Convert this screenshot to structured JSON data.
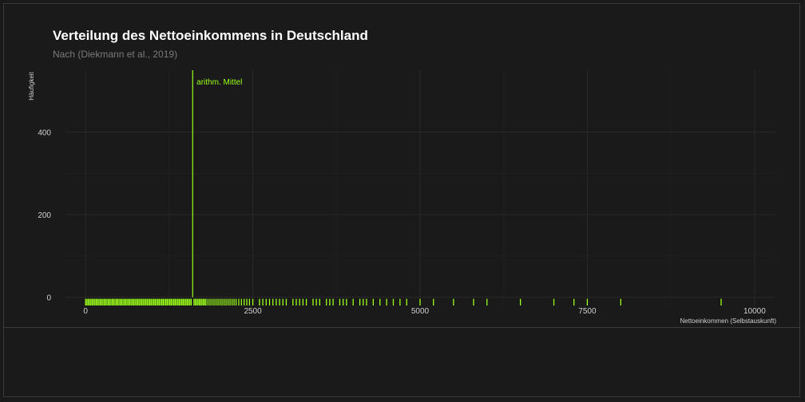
{
  "chart_data": {
    "type": "histogram",
    "title": "Verteilung des Nettoeinkommens in Deutschland",
    "subtitle": "Nach (Diekmann et al., 2019)",
    "xlabel": "Nettoeinkommen (Selbstauskunft)",
    "ylabel": "Häufigkeit",
    "xlim": [
      -300,
      10300
    ],
    "ylim": [
      -20,
      550
    ],
    "x_ticks": [
      0,
      2500,
      5000,
      7500,
      10000
    ],
    "x_tick_labels": [
      "0",
      "2500",
      "5000",
      "7500",
      "10000"
    ],
    "y_ticks": [
      0,
      200,
      400
    ],
    "y_tick_labels": [
      "0",
      "200",
      "400"
    ],
    "grid": true,
    "accent_color": "#9aff1a",
    "mean": {
      "label": "arithm. Mittel",
      "x": 1600
    },
    "bins": {
      "x": [
        1600
      ],
      "values": [
        550
      ]
    },
    "rug_x": [
      0,
      20,
      40,
      60,
      80,
      100,
      120,
      140,
      160,
      180,
      200,
      220,
      240,
      260,
      280,
      300,
      320,
      340,
      360,
      380,
      400,
      420,
      440,
      460,
      480,
      500,
      520,
      540,
      560,
      580,
      600,
      620,
      640,
      660,
      680,
      700,
      720,
      740,
      760,
      780,
      800,
      820,
      840,
      860,
      880,
      900,
      920,
      940,
      960,
      980,
      1000,
      1020,
      1040,
      1060,
      1080,
      1100,
      1120,
      1140,
      1160,
      1180,
      1200,
      1220,
      1240,
      1260,
      1280,
      1300,
      1320,
      1340,
      1360,
      1380,
      1400,
      1420,
      1440,
      1460,
      1480,
      1500,
      1520,
      1540,
      1560,
      1580,
      1620,
      1640,
      1660,
      1680,
      1700,
      1720,
      1740,
      1760,
      1780,
      1800,
      1830,
      1860,
      1890,
      1920,
      1950,
      1980,
      2010,
      2040,
      2070,
      2100,
      2130,
      2160,
      2190,
      2220,
      2250,
      2290,
      2330,
      2370,
      2410,
      2450,
      2500,
      2600,
      2650,
      2700,
      2750,
      2800,
      2850,
      2900,
      2950,
      3000,
      3100,
      3150,
      3200,
      3250,
      3300,
      3400,
      3450,
      3500,
      3600,
      3650,
      3700,
      3800,
      3850,
      3900,
      4000,
      4100,
      4150,
      4200,
      4300,
      4400,
      4500,
      4600,
      4700,
      4800,
      5000,
      5200,
      5500,
      5800,
      6000,
      6500,
      7000,
      7300,
      7500,
      8000,
      9500
    ]
  }
}
